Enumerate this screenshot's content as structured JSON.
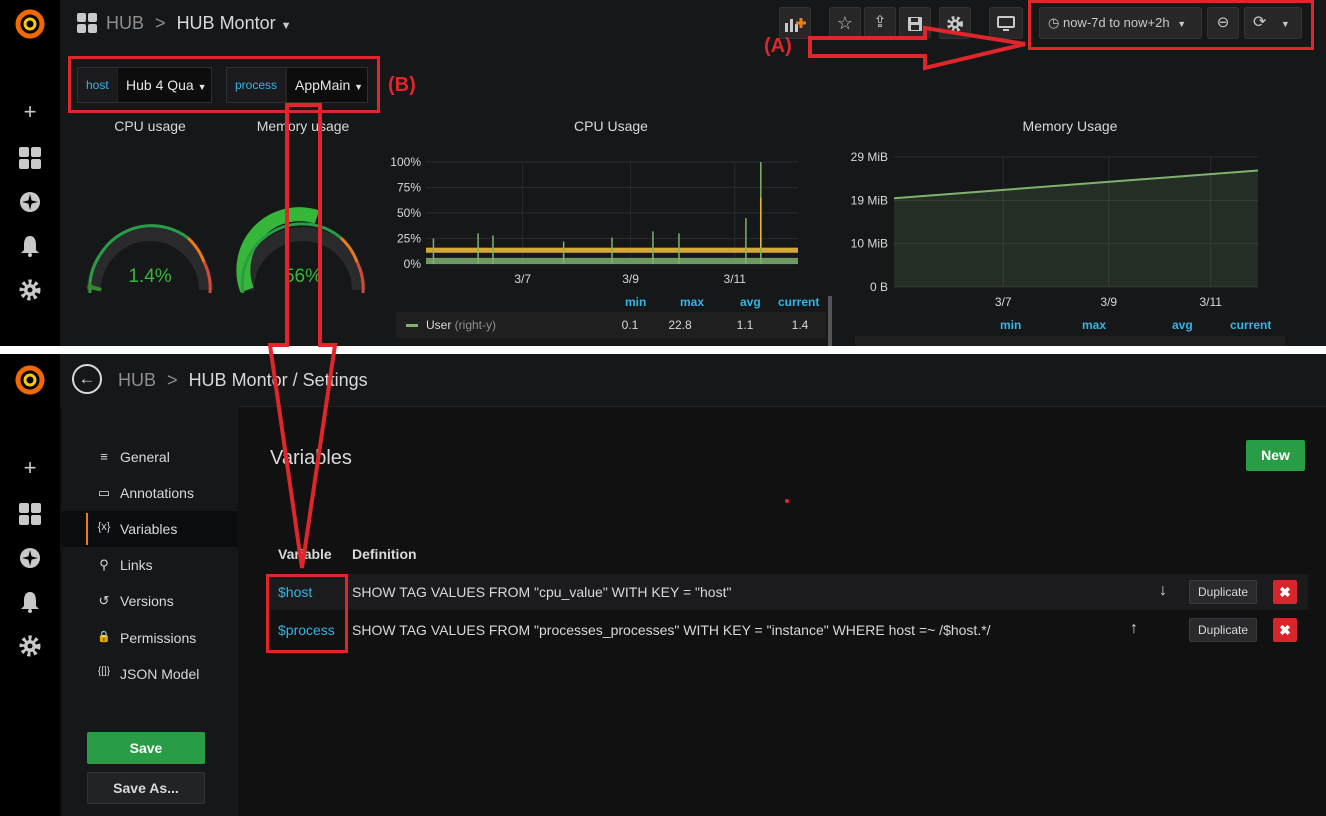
{
  "dashboard": {
    "breadcrumb_root": "HUB",
    "breadcrumb_sep": ">",
    "title": "HUB Montor",
    "time_range": "now-7d to now+2h",
    "variables": [
      {
        "label": "host",
        "value": "Hub 4 Qua"
      },
      {
        "label": "process",
        "value": "AppMain"
      }
    ],
    "annotations": {
      "a": "(A)",
      "b": "(B)"
    },
    "gauges": [
      {
        "title": "CPU usage",
        "value_text": "1.4%",
        "value": 1.4,
        "color": "#37872d"
      },
      {
        "title": "Memory usage",
        "value_text": "56%",
        "value": 56,
        "color": "#37872d"
      }
    ],
    "cpu_chart": {
      "title": "CPU Usage",
      "y_ticks": [
        "100%",
        "75%",
        "50%",
        "25%",
        "0%"
      ],
      "x_ticks": [
        "3/7",
        "3/9",
        "3/11"
      ],
      "legend_headers": [
        "min",
        "max",
        "avg",
        "current"
      ],
      "legend_rows": [
        {
          "name": "User",
          "suffix": "(right-y)",
          "color": "#7eb26d",
          "values": [
            "0.1",
            "22.8",
            "1.1",
            "1.4"
          ]
        }
      ]
    },
    "mem_chart": {
      "title": "Memory Usage",
      "y_ticks": [
        "29 MiB",
        "19 MiB",
        "10 MiB",
        "0 B"
      ],
      "x_ticks": [
        "3/7",
        "3/9",
        "3/11"
      ],
      "legend_headers": [
        "min",
        "max",
        "avg",
        "current"
      ]
    }
  },
  "chart_data": [
    {
      "type": "line",
      "title": "CPU Usage",
      "x_ticks": [
        "3/7",
        "3/9",
        "3/11"
      ],
      "ylim": [
        0,
        100
      ],
      "y_unit": "%",
      "series": [
        {
          "name": "User",
          "color": "#7eb26d",
          "min": 0.1,
          "max": 22.8,
          "avg": 1.1,
          "current": 1.4
        }
      ]
    },
    {
      "type": "area",
      "title": "Memory Usage",
      "x_ticks": [
        "3/7",
        "3/9",
        "3/11"
      ],
      "ylim": [
        0,
        29
      ],
      "y_unit": "MiB",
      "series": [
        {
          "color": "#7eb26d",
          "x_fraction": [
            0,
            1
          ],
          "values": [
            19.8,
            26.0
          ]
        }
      ]
    }
  ],
  "settings": {
    "breadcrumb_root": "HUB",
    "breadcrumb_sep": ">",
    "title": "HUB Montor / Settings",
    "nav": [
      {
        "icon": "≡",
        "label": "General"
      },
      {
        "icon": "▭",
        "label": "Annotations"
      },
      {
        "icon": "{x}",
        "label": "Variables"
      },
      {
        "icon": "⚲",
        "label": "Links"
      },
      {
        "icon": "↺",
        "label": "Versions"
      },
      {
        "icon": "🔒",
        "label": "Permissions"
      },
      {
        "icon": "{[]}",
        "label": "JSON Model"
      }
    ],
    "save_label": "Save",
    "save_as_label": "Save As...",
    "heading": "Variables",
    "new_label": "New",
    "col_variable": "Variable",
    "col_definition": "Definition",
    "rows": [
      {
        "name": "$host",
        "definition": "SHOW TAG VALUES FROM \"cpu_value\" WITH KEY = \"host\"",
        "move": "↓",
        "duplicate": "Duplicate",
        "delete": "✖"
      },
      {
        "name": "$process",
        "definition": "SHOW TAG VALUES FROM \"processes_processes\" WITH KEY = \"instance\" WHERE host =~ /$host.*/",
        "move": "↑",
        "duplicate": "Duplicate",
        "delete": "✖"
      }
    ]
  },
  "colors": {
    "accent_red": "#e0262a",
    "link_blue": "#33b5e5",
    "green_button": "#299c46",
    "graph_green": "#7eb26d",
    "graph_yellow": "#eab839"
  }
}
